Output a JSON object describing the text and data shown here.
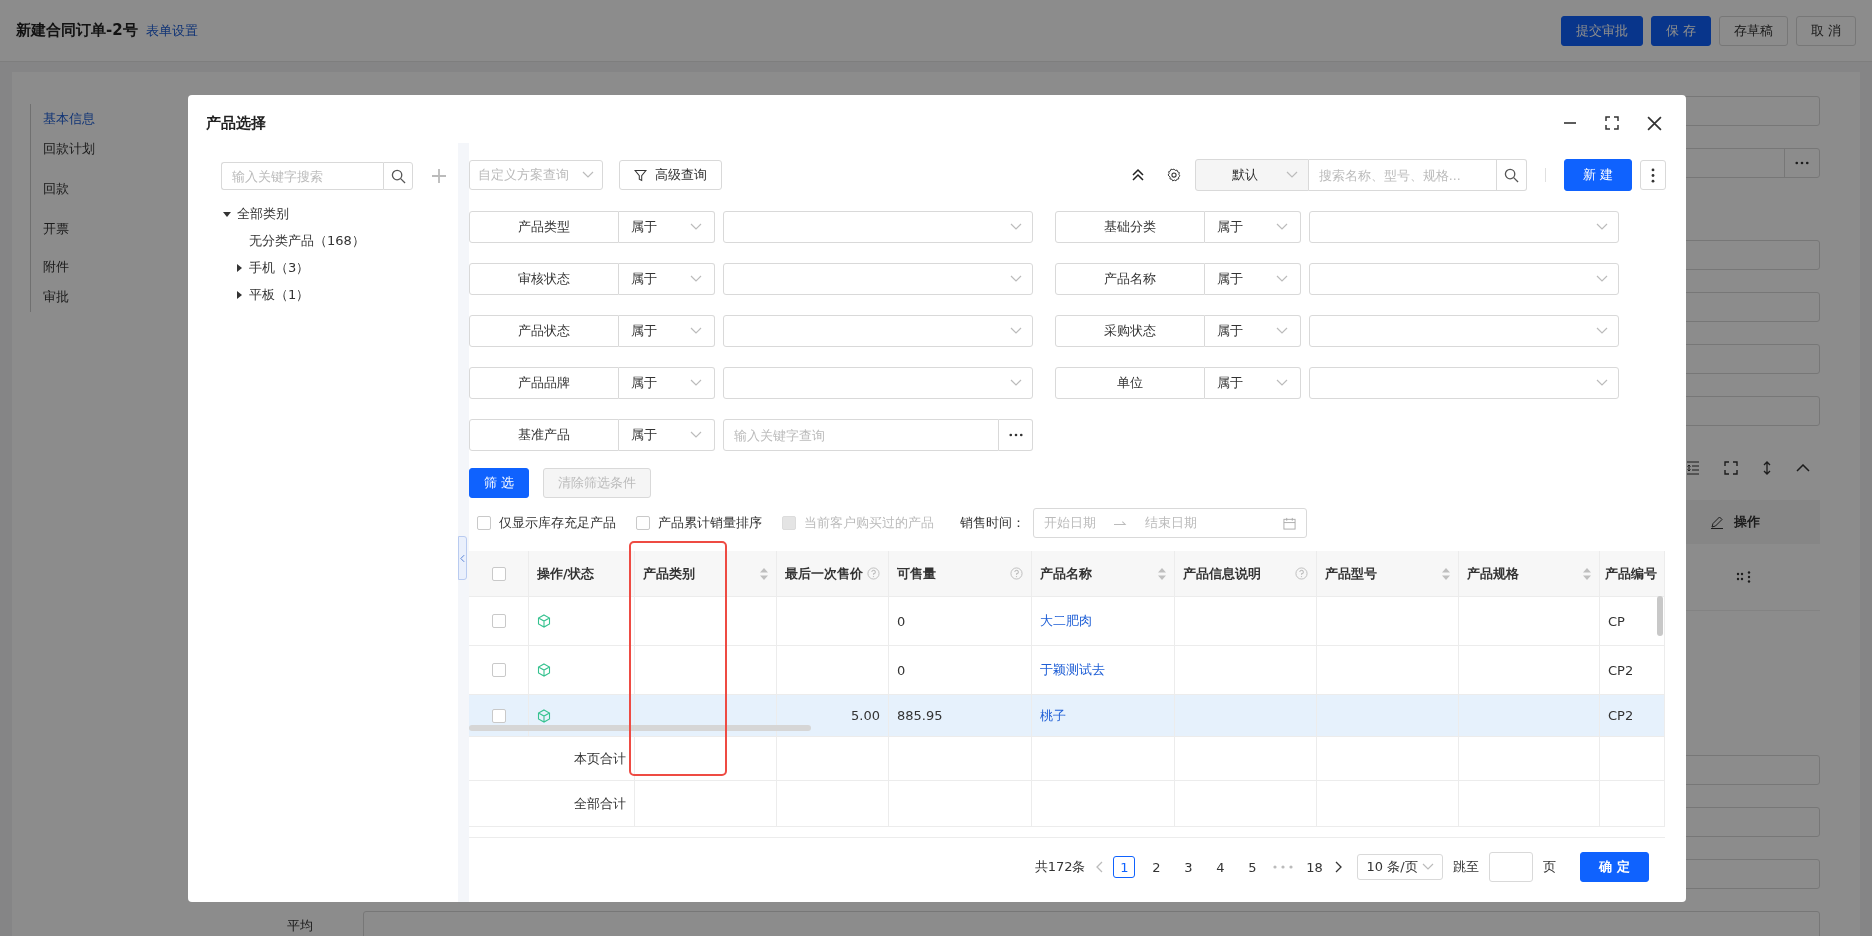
{
  "page": {
    "title": "新建合同订单-2号",
    "settings_link": "表单设置",
    "actions": [
      {
        "label": "提交审批",
        "primary": true
      },
      {
        "label": "保 存",
        "primary": true
      },
      {
        "label": "存草稿",
        "primary": false
      },
      {
        "label": "取 消",
        "primary": false
      }
    ]
  },
  "nav": [
    {
      "label": "基本信息",
      "selected": true
    },
    {
      "label": "回款计划",
      "selected": false
    },
    {
      "label": "回款",
      "selected": false
    },
    {
      "label": "开票",
      "selected": false
    },
    {
      "label": "附件",
      "selected": false
    },
    {
      "label": "审批",
      "selected": false
    }
  ],
  "background_table": {
    "column": "操作"
  },
  "background_field_label": "平均",
  "dialog": {
    "title": "产品选择",
    "tree": {
      "placeholder": "输入关键字搜索",
      "items": [
        {
          "label": "全部类别",
          "expanded": true,
          "children": [
            {
              "label": "无分类产品（168）"
            },
            {
              "label": "手机（3）",
              "expanded": false
            },
            {
              "label": "平板（1）",
              "expanded": false
            }
          ]
        }
      ]
    },
    "toolbar": {
      "scheme_placeholder": "自定义方案查询",
      "advanced": "高级查询",
      "sort": "默认",
      "search_placeholder": "搜索名称、型号、规格...",
      "new": "新 建"
    },
    "filters": [
      {
        "label": "产品类型",
        "operator": "属于",
        "kind": "select"
      },
      {
        "label": "基础分类",
        "operator": "属于",
        "kind": "select"
      },
      {
        "label": "审核状态",
        "operator": "属于",
        "kind": "select"
      },
      {
        "label": "产品名称",
        "operator": "属于",
        "kind": "select"
      },
      {
        "label": "产品状态",
        "operator": "属于",
        "kind": "select"
      },
      {
        "label": "采购状态",
        "operator": "属于",
        "kind": "select"
      },
      {
        "label": "产品品牌",
        "operator": "属于",
        "kind": "select"
      },
      {
        "label": "单位",
        "operator": "属于",
        "kind": "select"
      },
      {
        "label": "基准产品",
        "operator": "属于",
        "kind": "lookup",
        "placeholder": "输入关键字查询"
      }
    ],
    "filter_button": "筛 选",
    "clear_button": {
      "label": "清除筛选条件",
      "disabled": true
    },
    "options": [
      {
        "label": "仅显示库存充足产品",
        "checked": false,
        "disabled": false
      },
      {
        "label": "产品累计销量排序",
        "checked": false,
        "disabled": false
      },
      {
        "label": "当前客户购买过的产品",
        "checked": false,
        "disabled": true
      }
    ],
    "date_range": {
      "label": "销售时间：",
      "start_placeholder": "开始日期",
      "end_placeholder": "结束日期"
    },
    "table": {
      "select_all": {
        "checked": false
      },
      "columns": [
        {
          "label": "操作/状态",
          "sortable": false,
          "help": false,
          "highlighted": false
        },
        {
          "label": "产品类别",
          "sortable": true,
          "help": false,
          "highlighted": true
        },
        {
          "label": "最后一次售价",
          "sortable": false,
          "help": true,
          "highlighted": false
        },
        {
          "label": "可售量",
          "sortable": false,
          "help": true,
          "highlighted": false
        },
        {
          "label": "产品名称",
          "sortable": true,
          "help": false,
          "highlighted": false
        },
        {
          "label": "产品信息说明",
          "sortable": false,
          "help": true,
          "highlighted": false
        },
        {
          "label": "产品型号",
          "sortable": true,
          "help": false,
          "highlighted": false
        },
        {
          "label": "产品规格",
          "sortable": true,
          "help": false,
          "highlighted": false
        },
        {
          "label": "产品编号",
          "sortable": false,
          "help": false,
          "highlighted": false
        }
      ],
      "rows": [
        {
          "checked": false,
          "selected": false,
          "available": "0",
          "name": "大二肥肉",
          "code": "CP"
        },
        {
          "checked": false,
          "selected": false,
          "available": "0",
          "name": "于颖测试去",
          "code": "CP2"
        },
        {
          "checked": false,
          "selected": true,
          "last_price": "5.00",
          "available": "885.95",
          "name": "桃子",
          "code": "CP2"
        }
      ],
      "summaries": [
        "本页合计",
        "全部合计"
      ]
    },
    "pagination": {
      "total": "共172条",
      "pages": [
        {
          "kind": "page",
          "label": "1",
          "selected": true
        },
        {
          "kind": "page",
          "label": "2",
          "selected": false
        },
        {
          "kind": "page",
          "label": "3",
          "selected": false
        },
        {
          "kind": "page",
          "label": "4",
          "selected": false
        },
        {
          "kind": "page",
          "label": "5",
          "selected": false
        },
        {
          "kind": "ellipsis"
        },
        {
          "kind": "page",
          "label": "18",
          "selected": false
        }
      ],
      "page_size": "10 条/页",
      "jump_label": "跳至",
      "page_unit": "页",
      "confirm": "确 定"
    }
  }
}
